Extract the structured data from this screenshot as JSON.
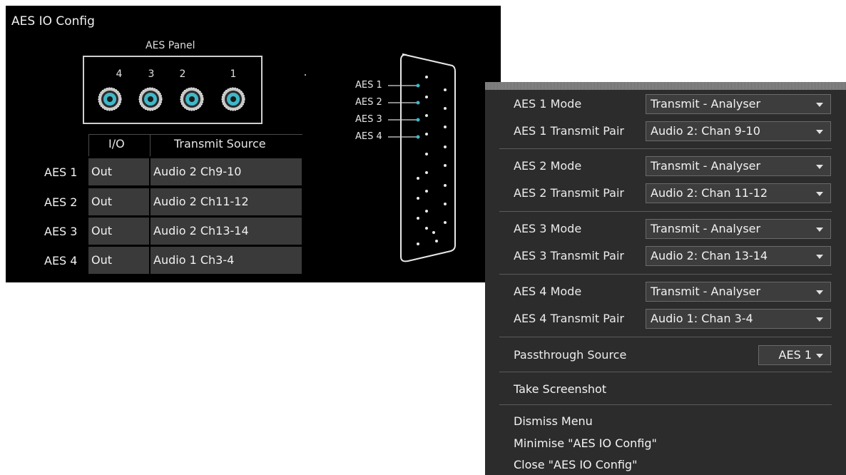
{
  "window": {
    "title": "AES IO Config",
    "panel_label": "AES Panel",
    "port_numbers": [
      "4",
      "3",
      "2",
      "1"
    ],
    "table": {
      "headers": [
        "I/O",
        "Transmit Source"
      ],
      "rows": [
        {
          "label": "AES 1",
          "io": "Out",
          "source": "Audio 2 Ch9-10"
        },
        {
          "label": "AES 2",
          "io": "Out",
          "source": "Audio 2 Ch11-12"
        },
        {
          "label": "AES 3",
          "io": "Out",
          "source": "Audio 2 Ch13-14"
        },
        {
          "label": "AES 4",
          "io": "Out",
          "source": "Audio 1 Ch3-4"
        }
      ]
    },
    "connector_labels": [
      "AES 1",
      "AES 2",
      "AES 3",
      "AES 4"
    ],
    "colors": {
      "bnc_center": "#3fb8c8",
      "pin_highlight": "#3fb8c8"
    }
  },
  "menu": {
    "groups": [
      {
        "mode_label": "AES 1 Mode",
        "mode_value": "Transmit - Analyser",
        "pair_label": "AES 1 Transmit Pair",
        "pair_value": "Audio 2: Chan 9-10"
      },
      {
        "mode_label": "AES 2 Mode",
        "mode_value": "Transmit - Analyser",
        "pair_label": "AES 2 Transmit Pair",
        "pair_value": "Audio 2: Chan 11-12"
      },
      {
        "mode_label": "AES 3 Mode",
        "mode_value": "Transmit - Analyser",
        "pair_label": "AES 3 Transmit Pair",
        "pair_value": "Audio 2: Chan 13-14"
      },
      {
        "mode_label": "AES 4 Mode",
        "mode_value": "Transmit - Analyser",
        "pair_label": "AES 4 Transmit Pair",
        "pair_value": "Audio 1: Chan 3-4"
      }
    ],
    "passthrough_label": "Passthrough Source",
    "passthrough_value": "AES 1",
    "take_screenshot": "Take Screenshot",
    "dismiss": "Dismiss Menu",
    "minimise": "Minimise \"AES IO Config\"",
    "close": "Close \"AES IO Config\""
  }
}
